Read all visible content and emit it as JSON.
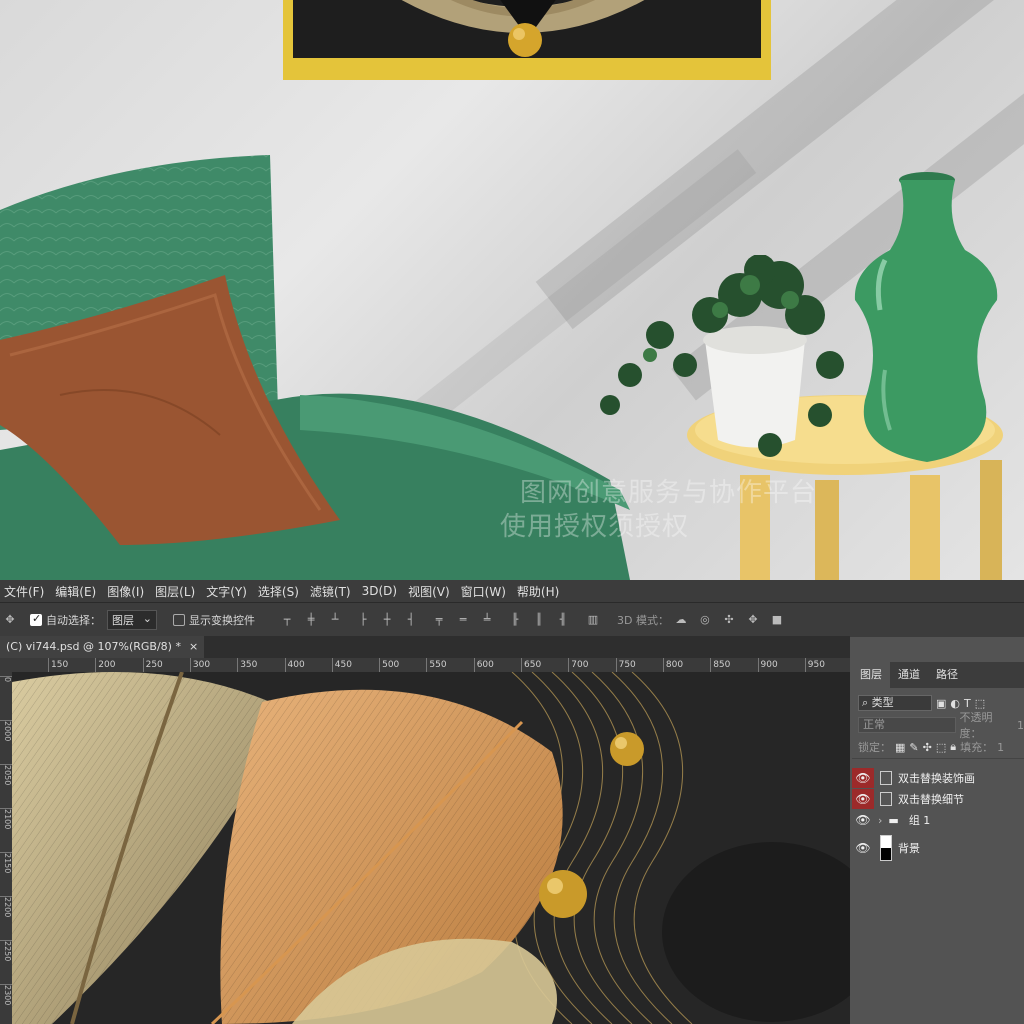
{
  "menu": [
    "文件(F)",
    "编辑(E)",
    "图像(I)",
    "图层(L)",
    "文字(Y)",
    "选择(S)",
    "滤镜(T)",
    "3D(D)",
    "视图(V)",
    "窗口(W)",
    "帮助(H)"
  ],
  "options": {
    "auto_select_label": "自动选择：",
    "auto_select_value": "图层",
    "show_transform_label": "显示变换控件",
    "mode3d_label": "3D 模式："
  },
  "document": {
    "tab_title": "(C) vi744.psd @ 107%(RGB/8) *",
    "close": "×"
  },
  "ruler_h": [
    "150",
    "200",
    "250",
    "300",
    "350",
    "400",
    "450",
    "500",
    "550",
    "600",
    "650",
    "700",
    "750",
    "800",
    "850",
    "900",
    "950"
  ],
  "ruler_v": [
    "0",
    "2000",
    "2050",
    "2100",
    "2150",
    "2200",
    "2250",
    "2300"
  ],
  "watermark": [
    "图网创意服务与协作平台",
    "使用授权须授权"
  ],
  "layers_panel": {
    "tabs": [
      "图层",
      "通道",
      "路径"
    ],
    "filter_value": "类型",
    "blend_mode": "正常",
    "opacity_label": "不透明度：",
    "opacity_value": "1",
    "lock_label": "锁定：",
    "fill_label": "填充：",
    "fill_value": "1",
    "layers": [
      {
        "name": "双击替换装饰画",
        "type": "smart",
        "eye_highlight": true
      },
      {
        "name": "双击替换细节",
        "type": "smart",
        "eye_highlight": true
      },
      {
        "name": "组 1",
        "type": "group",
        "eye_highlight": false
      },
      {
        "name": "背景",
        "type": "background",
        "eye_highlight": false
      }
    ]
  },
  "colors": {
    "sofa": "#3f8a68",
    "pillow": "#9a5532",
    "table": "#f0d27a",
    "vase": "#3c9a62",
    "frame": "#e4c43a",
    "eye_highlight": "#9c2a2a"
  }
}
